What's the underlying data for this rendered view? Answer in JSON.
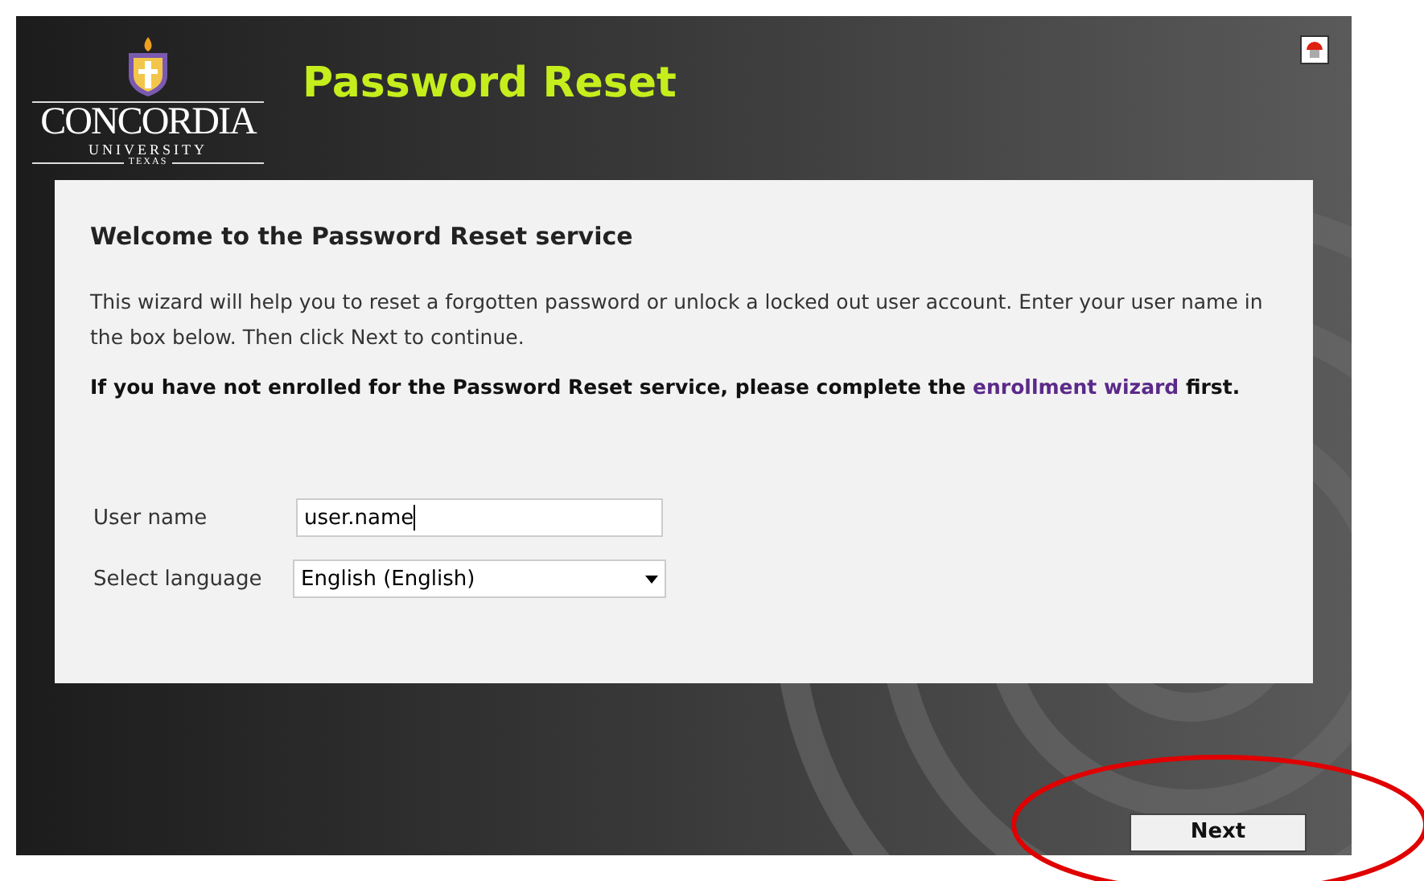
{
  "logo": {
    "name": "CONCORDIA",
    "line_2": "UNIVERSITY",
    "line_3": "TEXAS"
  },
  "header": {
    "title": "Password Reset"
  },
  "card": {
    "title": "Welcome to the Password Reset service",
    "intro": "This wizard will help you to reset a forgotten password or unlock a locked out user account. Enter your user name in the box below. Then click Next to continue.",
    "notice": {
      "before": "If you have not enrolled for the Password Reset service, please complete the",
      "link": "enrollment wizard",
      "after": "first."
    },
    "fields": [
      {
        "kind": "text",
        "label": "User name",
        "value": "user.name"
      },
      {
        "kind": "select",
        "label": "Select language",
        "value": "English (English)"
      }
    ]
  },
  "buttons": [
    "Next"
  ]
}
